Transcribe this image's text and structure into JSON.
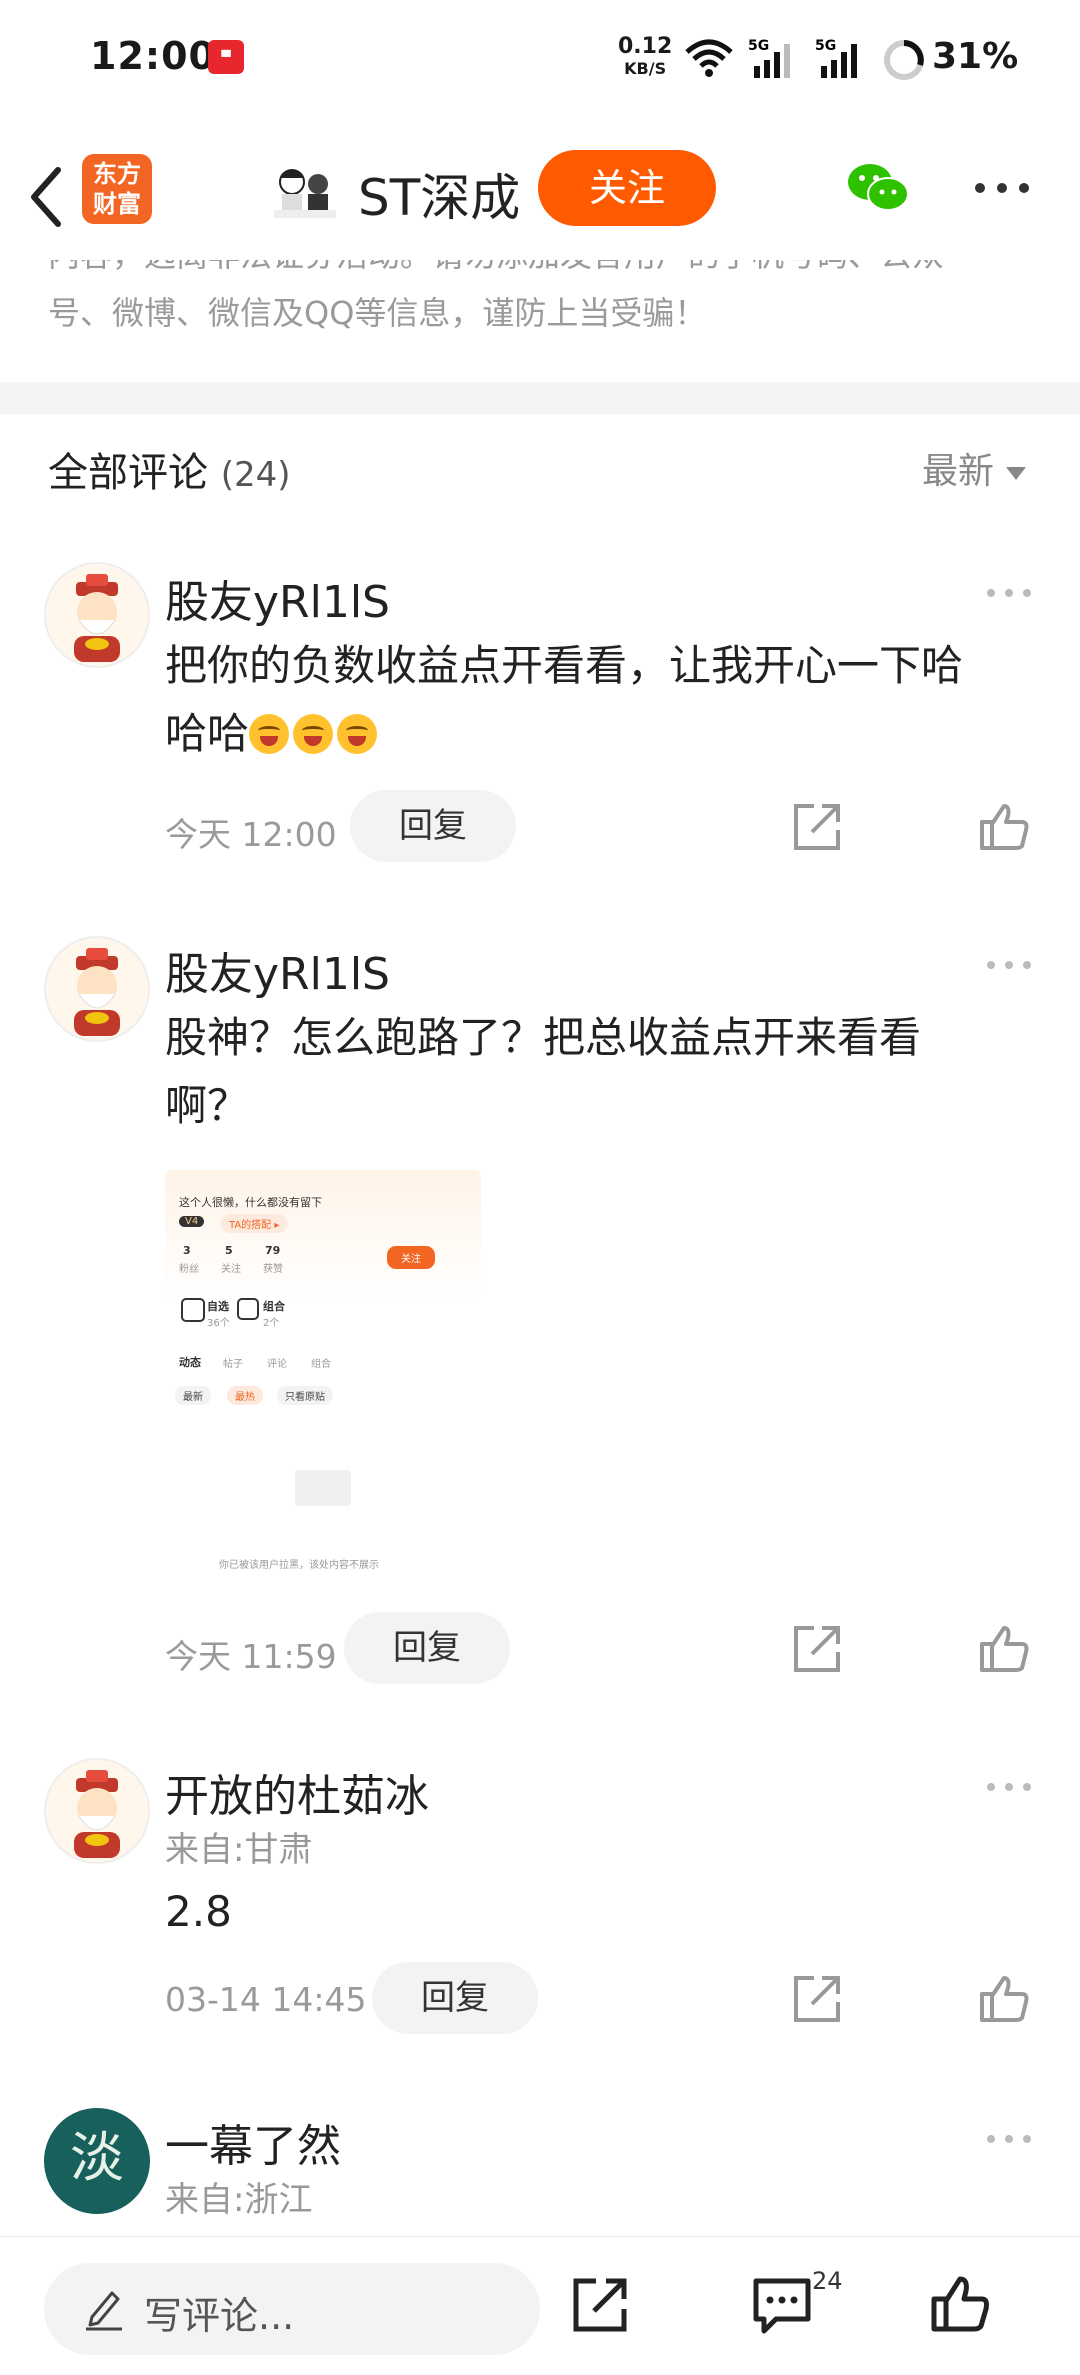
{
  "status_bar": {
    "time": "12:00",
    "net_speed": "0.12",
    "net_unit": "KB/S",
    "sig1": "5G",
    "sig2": "5G",
    "battery": "31%"
  },
  "header": {
    "brand_line1": "东方",
    "brand_line2": "财富",
    "stock_name": "ST深成",
    "follow_label": "关注"
  },
  "notice": {
    "line1": "内容，远离非法证券活动。请勿添加发言用户的手机号码、公众",
    "line2": "号、微博、微信及QQ等信息，谨防上当受骗！"
  },
  "comments_header": {
    "title": "全部评论",
    "count": "(24)",
    "sort": "最新"
  },
  "comments": [
    {
      "user": "股友yRl1lS",
      "text_a": "把你的负数收益点开看看，让我开心一下哈",
      "text_b": "哈哈",
      "time": "今天 12:00",
      "reply": "回复"
    },
    {
      "user": "股友yRl1lS",
      "text_a": "股神？怎么跑路了？把总收益点开来看看",
      "text_b": "啊？",
      "time": "今天 11:59",
      "reply": "回复",
      "image": {
        "bio": "这个人很懒，什么都没有留下",
        "tag": "TA的搭配 ▸",
        "level": "V4",
        "stats": [
          {
            "n": "3",
            "l": "粉丝"
          },
          {
            "n": "5",
            "l": "关注"
          },
          {
            "n": "79",
            "l": "获赞"
          }
        ],
        "follow": "关注",
        "fav": "自选",
        "fav_n": "36个",
        "combo": "组合",
        "combo_n": "2个",
        "tabs": [
          "动态",
          "帖子",
          "评论",
          "组合"
        ],
        "filters": [
          "最新",
          "最热",
          "只看原贴"
        ],
        "blocked": "你已被该用户拉黑，该处内容不展示"
      }
    },
    {
      "user": "开放的杜茹冰",
      "location": "来自:甘肃",
      "text": "2.8",
      "time": "03-14 14:45",
      "reply": "回复"
    },
    {
      "user": "一幕了然",
      "location": "来自:浙江",
      "avatar_char": "淡"
    }
  ],
  "bottom_bar": {
    "placeholder": "写评论...",
    "comment_count": "24"
  },
  "colors": {
    "accent": "#ff5a00",
    "brand": "#f26522",
    "wechat": "#2dc100"
  }
}
